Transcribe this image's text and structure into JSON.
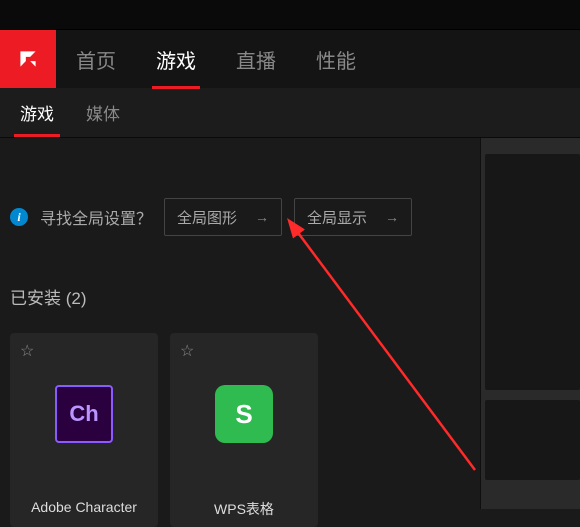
{
  "nav": {
    "items": [
      "首页",
      "游戏",
      "直播",
      "性能"
    ],
    "active_index": 1
  },
  "subnav": {
    "items": [
      "游戏",
      "媒体"
    ],
    "active_index": 0
  },
  "global": {
    "prompt": "寻找全局设置？",
    "btn_graphics": "全局图形",
    "btn_display": "全局显示"
  },
  "installed": {
    "header": "已安装 (2)",
    "apps": [
      {
        "name": "Adobe Character",
        "icon_text": "Ch",
        "icon_kind": "ch"
      },
      {
        "name": "WPS表格",
        "icon_text": "S",
        "icon_kind": "wps"
      }
    ]
  },
  "icons": {
    "info": "i",
    "arrow": "→",
    "star": "☆"
  }
}
